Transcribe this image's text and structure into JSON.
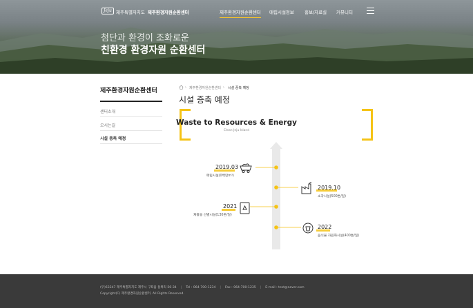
{
  "header": {
    "logo": "Jeju",
    "org": "제주특별자치도",
    "site_name": "제주환경자원순환센터",
    "nav": [
      {
        "label": "제주환경자원순환센터"
      },
      {
        "label": "매립시설정보"
      },
      {
        "label": "홍보/자료실"
      },
      {
        "label": "커뮤니티"
      }
    ],
    "hero_subtitle": "첨단과 환경이 조화로운",
    "hero_title": "친환경 환경자원 순환센터"
  },
  "sidebar": {
    "title": "제주환경자원순환센터",
    "items": [
      {
        "label": "센터소개"
      },
      {
        "label": "오시는길"
      },
      {
        "label": "시설 증축 예정"
      }
    ]
  },
  "breadcrumb": {
    "items": [
      "제주환경자원순환센터",
      "시설 증축 예정"
    ]
  },
  "page_title": "시설 증축 예정",
  "diagram": {
    "title": "Waste to Resources & Energy",
    "subtitle": "Clean Jeju Island",
    "accent": "#f5c315",
    "events": [
      {
        "year": "2019.03",
        "label": "매립시설(0백만m³)",
        "icon": "mining-cart-icon",
        "side": "left"
      },
      {
        "year": "2019.10",
        "label": "소각시설(500톤/일)",
        "icon": "factory-icon",
        "side": "right"
      },
      {
        "year": "2021",
        "label": "재활용 선별시설(130톤/일)",
        "icon": "recycle-bin-icon",
        "side": "left"
      },
      {
        "year": "2022",
        "label": "음식물 자원화시설(400톤/일)",
        "icon": "recycle-icon",
        "side": "right"
      }
    ]
  },
  "footer": {
    "address": "(우)63347 제주특별자치도 제주시 구좌읍 동복리 56-34",
    "tel": "Tel : 064-700-1234",
    "fax": "Fax : 064-700-1235",
    "email": "E-mail : test@naver.com",
    "copyright": "Copyright(C) 제주환경자원순환센터. All Rights Reserved."
  }
}
